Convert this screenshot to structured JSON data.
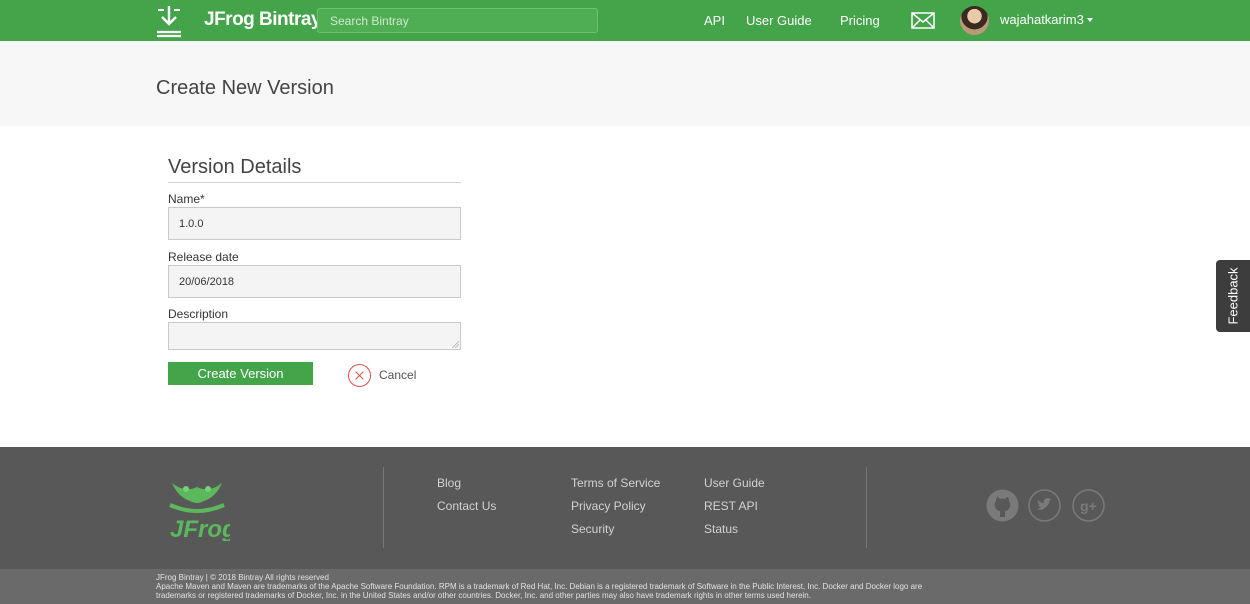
{
  "header": {
    "brand": "JFrog Bintray",
    "search_placeholder": "Search Bintray",
    "nav": {
      "api": "API",
      "user_guide": "User Guide",
      "pricing": "Pricing"
    },
    "username": "wajahatkarim3",
    "icons": {
      "logo": "download-arrow-icon",
      "mail": "mail-icon",
      "avatar": "user-avatar",
      "dropdown": "caret-down-icon"
    },
    "accent_color": "#44a44a"
  },
  "page": {
    "title": "Create New Version"
  },
  "form": {
    "section_title": "Version Details",
    "name_label": "Name*",
    "name_value": "1.0.0",
    "release_label": "Release date",
    "release_value": "20/06/2018",
    "description_label": "Description",
    "description_value": "",
    "submit_label": "Create Version",
    "cancel_label": "Cancel"
  },
  "feedback": {
    "label": "Feedback"
  },
  "footer": {
    "col1": [
      "Blog",
      "Contact Us"
    ],
    "col2": [
      "Terms of Service",
      "Privacy Policy",
      "Security"
    ],
    "col3": [
      "User Guide",
      "REST API",
      "Status"
    ],
    "social": [
      "github-icon",
      "twitter-icon",
      "google-plus-icon"
    ],
    "copyright": "JFrog Bintray | © 2018 Bintray All rights reserved",
    "trademark_1": "Apache Maven and Maven are trademarks of the Apache Software Foundation. RPM is a trademark of Red Hat, Inc. Debian is a registered trademark of Software in the Public Interest, Inc. Docker and Docker logo are",
    "trademark_2": "trademarks or registered trademarks of Docker, Inc. in the United States and/or other countries. Docker, Inc. and other parties may also have trademark rights in other terms used herein."
  }
}
